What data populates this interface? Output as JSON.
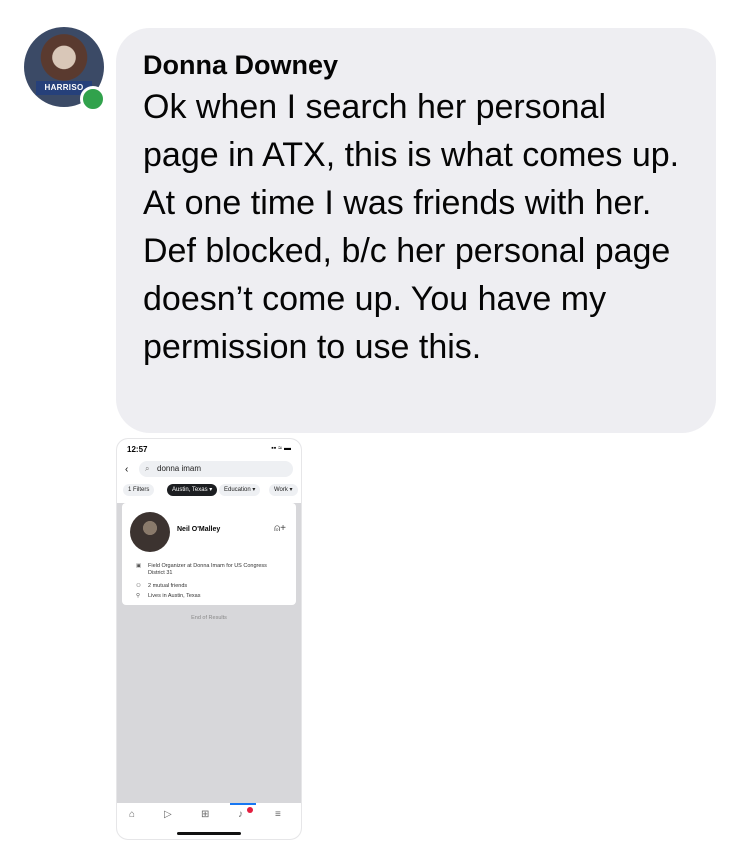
{
  "comment": {
    "avatar_badge_text": "HARRISO",
    "sender": "Donna Downey",
    "message": "Ok when I search her personal page in ATX, this is what comes up. At one time I was friends with her. Def blocked, b/c her personal page doesn’t come up. You have my permission to use this."
  },
  "screenshot": {
    "time": "12:57",
    "status": "▪▪ ≈ ▬",
    "back_icon": "‹",
    "search_query": "donna imam",
    "chips": {
      "filters_count": "1",
      "filters": "Filters",
      "location": "Austin, Texas",
      "education": "Education",
      "work": "Work"
    },
    "result": {
      "name": "Neil O'Malley",
      "job": "Field Organizer at Donna Imam for US Congress District 31",
      "mutual": "2 mutual friends",
      "lives": "Lives in Austin, Texas"
    },
    "end_text": "End of Results"
  },
  "colors": {
    "bubble": "#eeeef2",
    "online": "#31a24c",
    "accent": "#1877f2"
  }
}
